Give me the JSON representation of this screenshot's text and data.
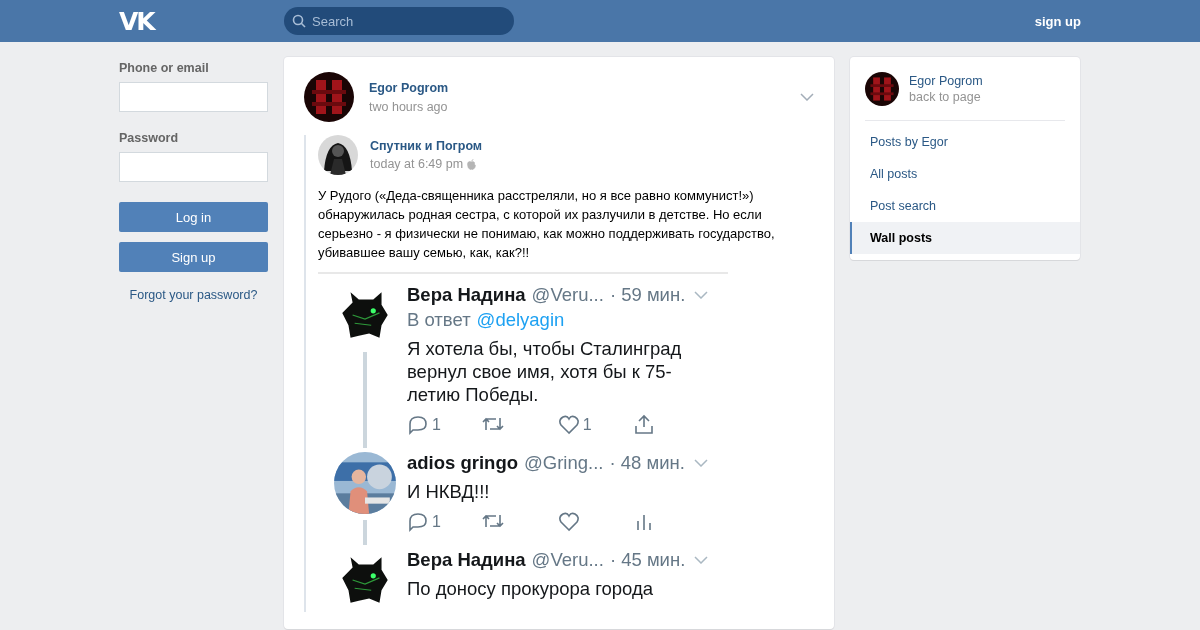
{
  "header": {
    "logo": "VK",
    "search": {
      "placeholder": "Search"
    },
    "signup": "sign up"
  },
  "login": {
    "fields": [
      {
        "label": "Phone or email"
      },
      {
        "label": "Password"
      }
    ],
    "buttons": [
      "Log in",
      "Sign up"
    ],
    "forgot": "Forgot your password?"
  },
  "post": {
    "author": "Egor Pogrom",
    "time": "two hours ago",
    "repost": {
      "author": "Спутник и Погром",
      "time": "today at 6:49 pm",
      "text": "У Рудого («Деда-священника расстреляли, но я все равно коммунист!») обнаружилась родная сестра, с которой их разлучили в детстве. Но если серьезно - я физически не понимаю, как можно поддерживать государство, убивавшее вашу семью, как, как?!!",
      "tweets": [
        {
          "kind": "cat",
          "name": "Вера Надина",
          "handle": "@Veru...",
          "time": "· 59 мин.",
          "reply_label": "В ответ",
          "reply_handle": "@delyagin",
          "text": "Я хотела бы, чтобы Сталинград вернул свое имя, хотя бы к 75-летию Победы.",
          "thread": true,
          "actions": [
            {
              "kind": "reply",
              "count": "1"
            },
            {
              "kind": "retweet"
            },
            {
              "kind": "like",
              "count": "1"
            },
            {
              "kind": "share"
            }
          ]
        },
        {
          "name": "adios gringo",
          "handle": "@Gring...",
          "time": "· 48 мин.",
          "text": "И НКВД!!!",
          "thread": true,
          "actions": [
            {
              "kind": "reply",
              "count": "1"
            },
            {
              "kind": "retweet"
            },
            {
              "kind": "like"
            },
            {
              "kind": "stats"
            }
          ]
        },
        {
          "kind": "cat",
          "name": "Вера Надина",
          "handle": "@Veru...",
          "time": "· 45 мин.",
          "text": "По доносу прокурора города",
          "thread": false
        }
      ]
    }
  },
  "side": {
    "name": "Egor Pogrom",
    "back": "back to page",
    "items": [
      {
        "label": "Posts by Egor",
        "selected": false
      },
      {
        "label": "All posts",
        "selected": false
      },
      {
        "label": "Post search",
        "selected": false
      },
      {
        "label": "Wall posts",
        "selected": true
      }
    ]
  }
}
